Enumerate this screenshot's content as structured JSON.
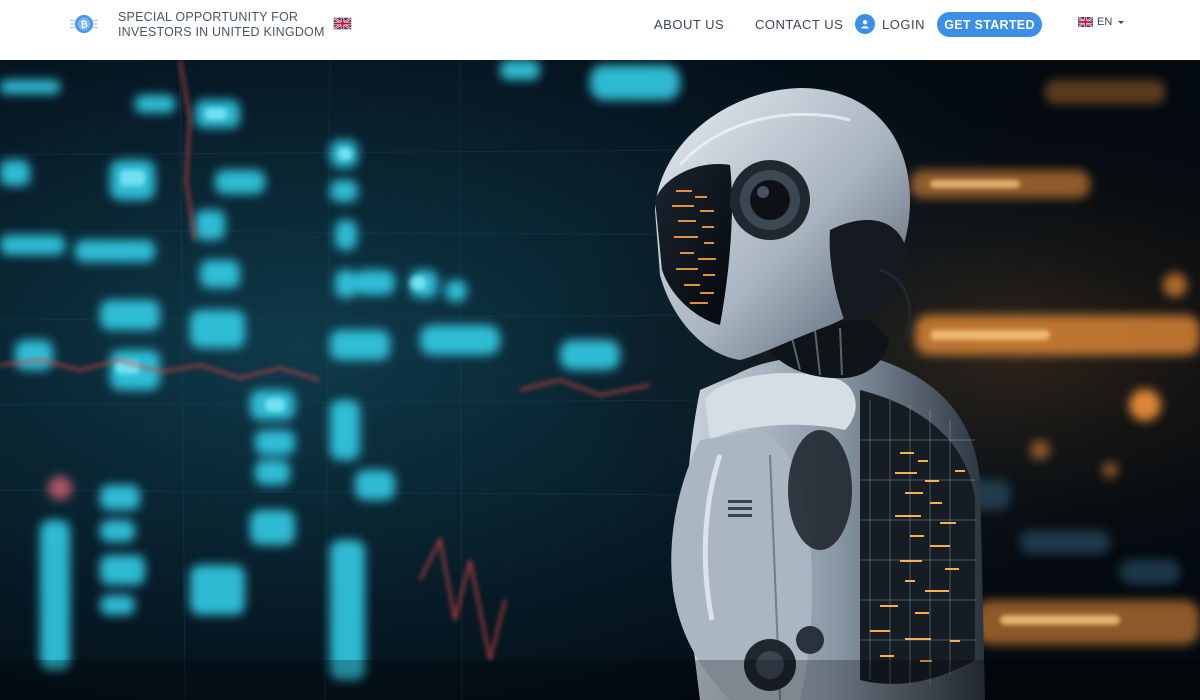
{
  "header": {
    "logo_icon": "bitcoin-coin-icon",
    "tagline_line1": "SPECIAL OPPORTUNITY FOR",
    "tagline_line2": "INVESTORS IN UNITED KINGDOM",
    "country_flag_icon": "uk-flag-icon"
  },
  "nav": {
    "about": "ABOUT US",
    "contact": "CONTACT US",
    "login": "LOGIN",
    "login_icon": "user-icon",
    "get_started": "GET STARTED",
    "language": "EN",
    "language_flag_icon": "uk-flag-icon"
  },
  "hero": {
    "image": "robot-trading-screens-image"
  },
  "colors": {
    "accent": "#3d8ee8",
    "nav_text": "#3c4656",
    "hero_cyan": "#35d6f0",
    "hero_orange": "#ff9a3c"
  }
}
